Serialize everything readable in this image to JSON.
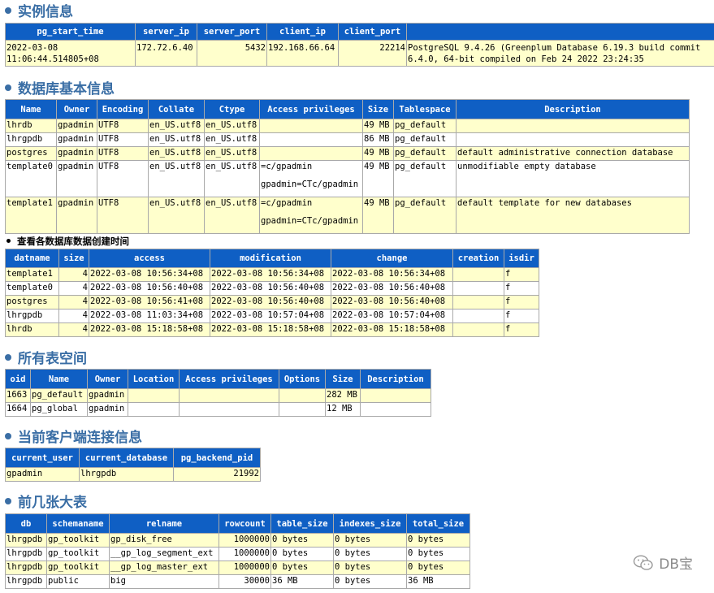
{
  "sections": {
    "instance": "实例信息",
    "databases": "数据库基本信息",
    "db_times": "查看各数据库数据创建时间",
    "tablespaces": "所有表空间",
    "client": "当前客户端连接信息",
    "top_tables": "前几张大表"
  },
  "instance": {
    "headers": [
      "pg_start_time",
      "server_ip",
      "server_port",
      "client_ip",
      "client_port",
      ""
    ],
    "row": {
      "pg_start_time_1": "2022-03-08",
      "pg_start_time_2": "11:06:44.514805+08",
      "server_ip": "172.72.6.40",
      "server_port": "5432",
      "client_ip": "192.168.66.64",
      "client_port": "22214",
      "version_1": "PostgreSQL 9.4.26 (Greenplum Database 6.19.3 build commit",
      "version_2": "6.4.0, 64-bit compiled on Feb 24 2022 23:24:35"
    }
  },
  "databases": {
    "headers": [
      "Name",
      "Owner",
      "Encoding",
      "Collate",
      "Ctype",
      "Access privileges",
      "Size",
      "Tablespace",
      "Description"
    ],
    "rows": [
      [
        "lhrdb",
        "gpadmin",
        "UTF8",
        "en_US.utf8",
        "en_US.utf8",
        "",
        "",
        "49 MB",
        "pg_default",
        ""
      ],
      [
        "lhrgpdb",
        "gpadmin",
        "UTF8",
        "en_US.utf8",
        "en_US.utf8",
        "",
        "",
        "86 MB",
        "pg_default",
        ""
      ],
      [
        "postgres",
        "gpadmin",
        "UTF8",
        "en_US.utf8",
        "en_US.utf8",
        "",
        "",
        "49 MB",
        "pg_default",
        "default administrative connection database"
      ],
      [
        "template0",
        "gpadmin",
        "UTF8",
        "en_US.utf8",
        "en_US.utf8",
        "=c/gpadmin",
        "gpadmin=CTc/gpadmin",
        "49 MB",
        "pg_default",
        "unmodifiable empty database"
      ],
      [
        "template1",
        "gpadmin",
        "UTF8",
        "en_US.utf8",
        "en_US.utf8",
        "=c/gpadmin",
        "gpadmin=CTc/gpadmin",
        "49 MB",
        "pg_default",
        "default template for new databases"
      ]
    ]
  },
  "db_times": {
    "headers": [
      "datname",
      "size",
      "access",
      "modification",
      "change",
      "creation",
      "isdir"
    ],
    "rows": [
      [
        "template1",
        "4",
        "2022-03-08 10:56:34+08",
        "2022-03-08 10:56:34+08",
        "2022-03-08 10:56:34+08",
        "",
        "f"
      ],
      [
        "template0",
        "4",
        "2022-03-08 10:56:40+08",
        "2022-03-08 10:56:40+08",
        "2022-03-08 10:56:40+08",
        "",
        "f"
      ],
      [
        "postgres",
        "4",
        "2022-03-08 10:56:41+08",
        "2022-03-08 10:56:40+08",
        "2022-03-08 10:56:40+08",
        "",
        "f"
      ],
      [
        "lhrgpdb",
        "4",
        "2022-03-08 11:03:34+08",
        "2022-03-08 10:57:04+08",
        "2022-03-08 10:57:04+08",
        "",
        "f"
      ],
      [
        "lhrdb",
        "4",
        "2022-03-08 15:18:58+08",
        "2022-03-08 15:18:58+08",
        "2022-03-08 15:18:58+08",
        "",
        "f"
      ]
    ]
  },
  "tablespaces": {
    "headers": [
      "oid",
      "Name",
      "Owner",
      "Location",
      "Access privileges",
      "Options",
      "Size",
      "Description"
    ],
    "rows": [
      [
        "1663",
        "pg_default",
        "gpadmin",
        "",
        "",
        "",
        "282 MB",
        ""
      ],
      [
        "1664",
        "pg_global",
        "gpadmin",
        "",
        "",
        "",
        "12 MB",
        ""
      ]
    ]
  },
  "client": {
    "headers": [
      "current_user",
      "current_database",
      "pg_backend_pid"
    ],
    "rows": [
      [
        "gpadmin",
        "lhrgpdb",
        "21992"
      ]
    ]
  },
  "top_tables": {
    "headers": [
      "db",
      "schemaname",
      "relname",
      "rowcount",
      "table_size",
      "indexes_size",
      "total_size"
    ],
    "rows": [
      [
        "lhrgpdb",
        "gp_toolkit",
        "gp_disk_free",
        "1000000",
        "0 bytes",
        "0 bytes",
        "0 bytes"
      ],
      [
        "lhrgpdb",
        "gp_toolkit",
        "__gp_log_segment_ext",
        "1000000",
        "0 bytes",
        "0 bytes",
        "0 bytes"
      ],
      [
        "lhrgpdb",
        "gp_toolkit",
        "__gp_log_master_ext",
        "1000000",
        "0 bytes",
        "0 bytes",
        "0 bytes"
      ],
      [
        "lhrgpdb",
        "public",
        "big",
        "30000",
        "36 MB",
        "0 bytes",
        "36 MB"
      ]
    ]
  },
  "watermark": {
    "text": "DB宝",
    "icon": "wechat-icon"
  },
  "colors": {
    "header_bg": "#0f5fc4",
    "row_alt": "#ffffcc",
    "title": "#3a6ea5"
  }
}
